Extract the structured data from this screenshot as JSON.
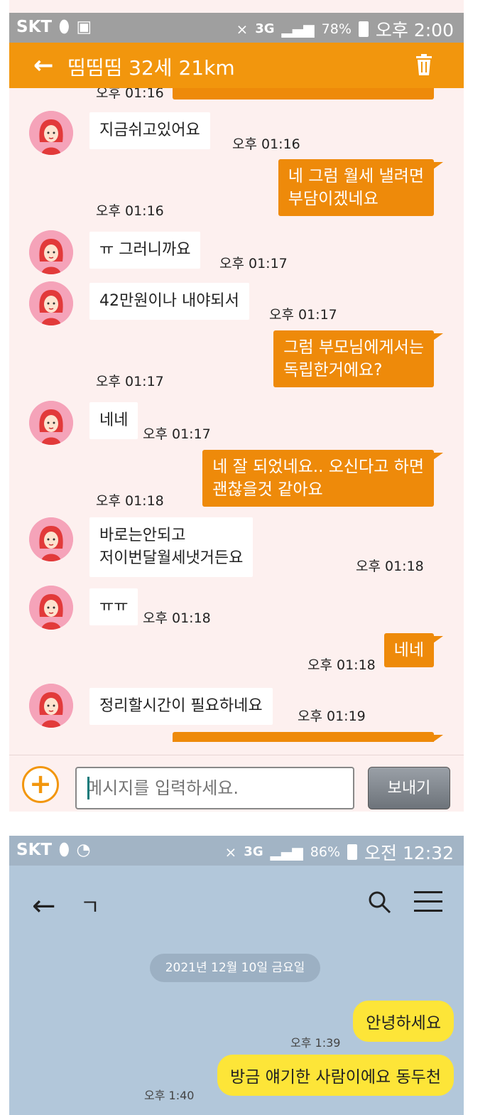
{
  "top": {
    "status": {
      "carrier": "SKT",
      "net": "3G",
      "battery": "78%",
      "clock": "오후 2:00"
    },
    "header": {
      "back": "←",
      "title": "띰띰띰 32세 21km"
    },
    "messages": [
      {
        "dir": "out",
        "text": "",
        "time": "오후 01:16",
        "cut": true
      },
      {
        "dir": "in",
        "text": "지금쉬고있어요",
        "time": "오후 01:16"
      },
      {
        "dir": "out",
        "text": "네 그럼 월세 낼려면\n부담이겠네요",
        "time": "오후 01:16"
      },
      {
        "dir": "in",
        "text": "ㅠ 그러니까요",
        "time": "오후 01:17"
      },
      {
        "dir": "in",
        "text": "42만원이나 내야되서",
        "time": "오후 01:17"
      },
      {
        "dir": "out",
        "text": "그럼 부모님에게서는\n독립한거에요?",
        "time": "오후 01:17"
      },
      {
        "dir": "in",
        "text": "네네",
        "time": "오후 01:17"
      },
      {
        "dir": "out",
        "text": "네 잘 되었네요.. 오신다고 하면\n괜찮을것 같아요",
        "time": "오후 01:18"
      },
      {
        "dir": "in",
        "text": "바로는안되고\n저이번달월세냇거든요",
        "time": "오후 01:18"
      },
      {
        "dir": "in",
        "text": "ㅠㅠ",
        "time": "오후 01:18"
      },
      {
        "dir": "out",
        "text": "네네",
        "time": "오후 01:18"
      },
      {
        "dir": "in",
        "text": "정리할시간이 필요하네요",
        "time": "오후 01:19"
      }
    ],
    "input": {
      "placeholder": "메시지를 입력하세요.",
      "send": "보내기",
      "plus": "+"
    }
  },
  "bottom": {
    "status": {
      "carrier": "SKT",
      "net": "3G",
      "battery": "86%",
      "clock": "오전 12:32"
    },
    "header": {
      "back": "←",
      "title": "ㄱ"
    },
    "date": "2021년 12월 10일 금요일",
    "messages": [
      {
        "text": "안녕하세요",
        "time": "오후 1:39"
      },
      {
        "text": "방금 얘기한 사람이에요 동두천",
        "time": "오후 1:40"
      }
    ]
  },
  "colors": {
    "accent": "#f2960d",
    "outgoing": "#ee8a0a",
    "chat_bg": "#fdf0ef",
    "kakao_bg": "#b2c7da",
    "kakao_bubble": "#fde538"
  }
}
